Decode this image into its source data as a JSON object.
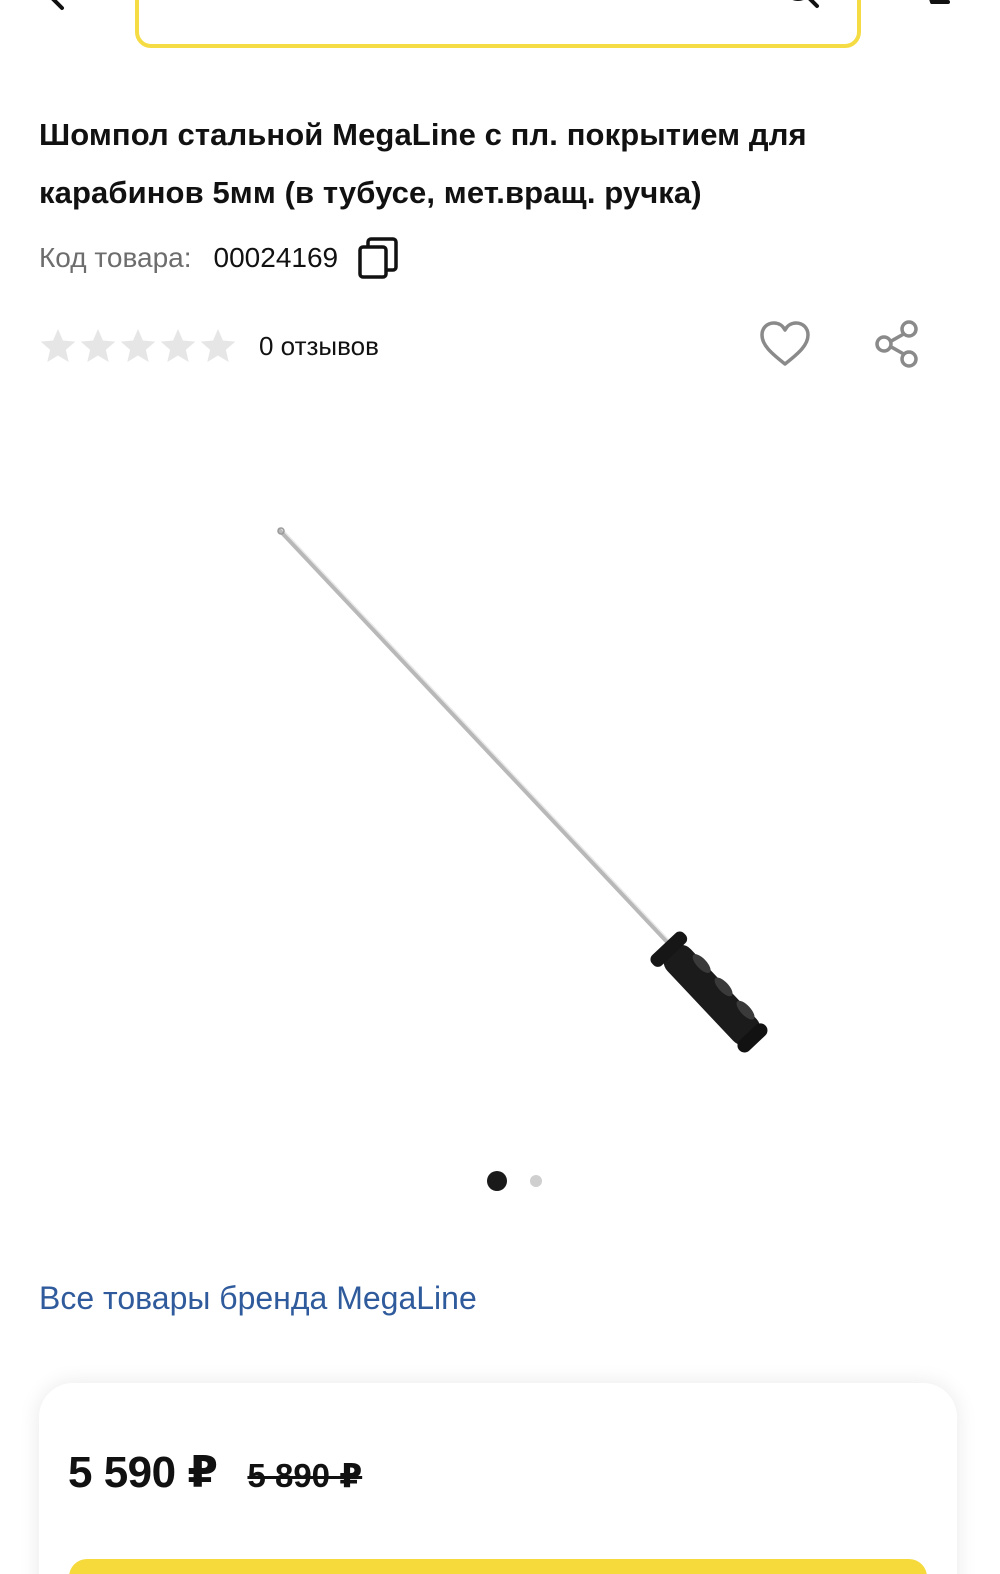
{
  "header": {
    "search_placeholder": "",
    "search_border_color": "#f5dc45"
  },
  "product": {
    "title": "Шомпол стальной MegaLine с пл. покрытием для карабинов 5мм (в тубусе, мет.вращ. ручка)",
    "code_label": "Код товара:",
    "code_value": "00024169",
    "rating": {
      "stars_filled": 0,
      "stars_total": 5,
      "reviews_label": "0 отзывов"
    },
    "gallery": {
      "current_index": 1,
      "total_images": 2
    },
    "brand_link": "Все товары бренда MegaLine"
  },
  "price": {
    "current": "5 590 ₽",
    "old": "5 890 ₽"
  },
  "colors": {
    "accent_yellow": "#f6da3c",
    "link_blue": "#2f5b9c",
    "star_empty": "#e6e6e6",
    "icon_gray": "#8a8a8a"
  }
}
